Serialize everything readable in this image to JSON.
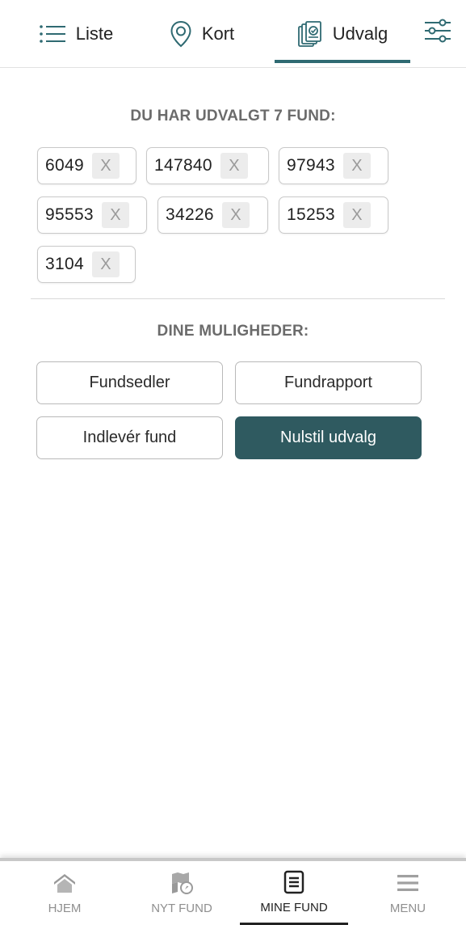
{
  "top_tabs": {
    "liste": {
      "label": "Liste",
      "icon": "list-icon"
    },
    "kort": {
      "label": "Kort",
      "icon": "map-pin-icon"
    },
    "udvalg": {
      "label": "Udvalg",
      "icon": "selection-documents-icon",
      "active": true
    },
    "filter": {
      "icon": "filter-sliders-icon"
    }
  },
  "selection": {
    "title": "DU HAR UDVALGT 7 FUND:",
    "remove_label": "X",
    "items": [
      "6049",
      "147840",
      "97943",
      "95553",
      "34226",
      "15253",
      "3104"
    ]
  },
  "options": {
    "title": "DINE MULIGHEDER:",
    "buttons": [
      "Fundsedler",
      "Fundrapport",
      "Indlevér fund",
      "Nulstil udvalg"
    ]
  },
  "bottom_nav": {
    "items": [
      {
        "label": "HJEM",
        "icon": "home-icon"
      },
      {
        "label": "NYT FUND",
        "icon": "new-find-map-icon"
      },
      {
        "label": "MINE FUND",
        "icon": "my-finds-document-icon",
        "active": true
      },
      {
        "label": "MENU",
        "icon": "menu-icon"
      }
    ]
  },
  "colors": {
    "accent": "#2f6a72",
    "primary_button": "#2f5a60",
    "muted_text": "#8f8f8f"
  }
}
